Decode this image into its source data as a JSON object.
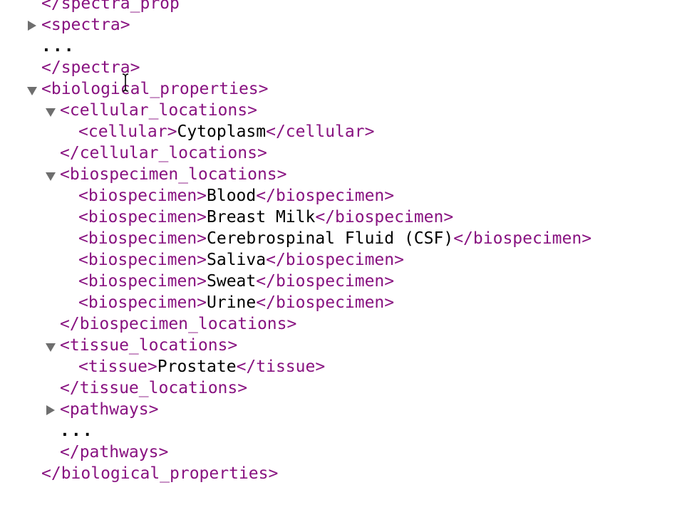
{
  "lines": {
    "l0": {
      "tag": "</spectra_prop"
    },
    "l1": {
      "tag": "<spectra>"
    },
    "l2": {
      "text": "..."
    },
    "l3": {
      "tag": "</spectra>"
    },
    "l4": {
      "tag": "<biological_properties>"
    },
    "l5": {
      "tag": "<cellular_locations>"
    },
    "l6": {
      "open": "<cellular>",
      "text": "Cytoplasm",
      "close": "</cellular>"
    },
    "l7": {
      "tag": "</cellular_locations>"
    },
    "l8": {
      "tag": "<biospecimen_locations>"
    },
    "l9": {
      "open": "<biospecimen>",
      "text": "Blood",
      "close": "</biospecimen>"
    },
    "l10": {
      "open": "<biospecimen>",
      "text": "Breast Milk",
      "close": "</biospecimen>"
    },
    "l11": {
      "open": "<biospecimen>",
      "text": "Cerebrospinal Fluid (CSF)",
      "close": "</biospecimen>"
    },
    "l12": {
      "open": "<biospecimen>",
      "text": "Saliva",
      "close": "</biospecimen>"
    },
    "l13": {
      "open": "<biospecimen>",
      "text": "Sweat",
      "close": "</biospecimen>"
    },
    "l14": {
      "open": "<biospecimen>",
      "text": "Urine",
      "close": "</biospecimen>"
    },
    "l15": {
      "tag": "</biospecimen_locations>"
    },
    "l16": {
      "tag": "<tissue_locations>"
    },
    "l17": {
      "open": "<tissue>",
      "text": "Prostate",
      "close": "</tissue>"
    },
    "l18": {
      "tag": "</tissue_locations>"
    },
    "l19": {
      "tag": "<pathways>"
    },
    "l20": {
      "text": "..."
    },
    "l21": {
      "tag": "</pathways>"
    },
    "l22": {
      "tag": "</biological_properties>"
    }
  },
  "colors": {
    "tag": "#881280",
    "text": "#000000",
    "toggle": "#6e6e6e"
  },
  "icons": {
    "collapsed": "triangle-right-icon",
    "expanded": "triangle-down-icon",
    "cursor": "text-cursor-icon"
  }
}
